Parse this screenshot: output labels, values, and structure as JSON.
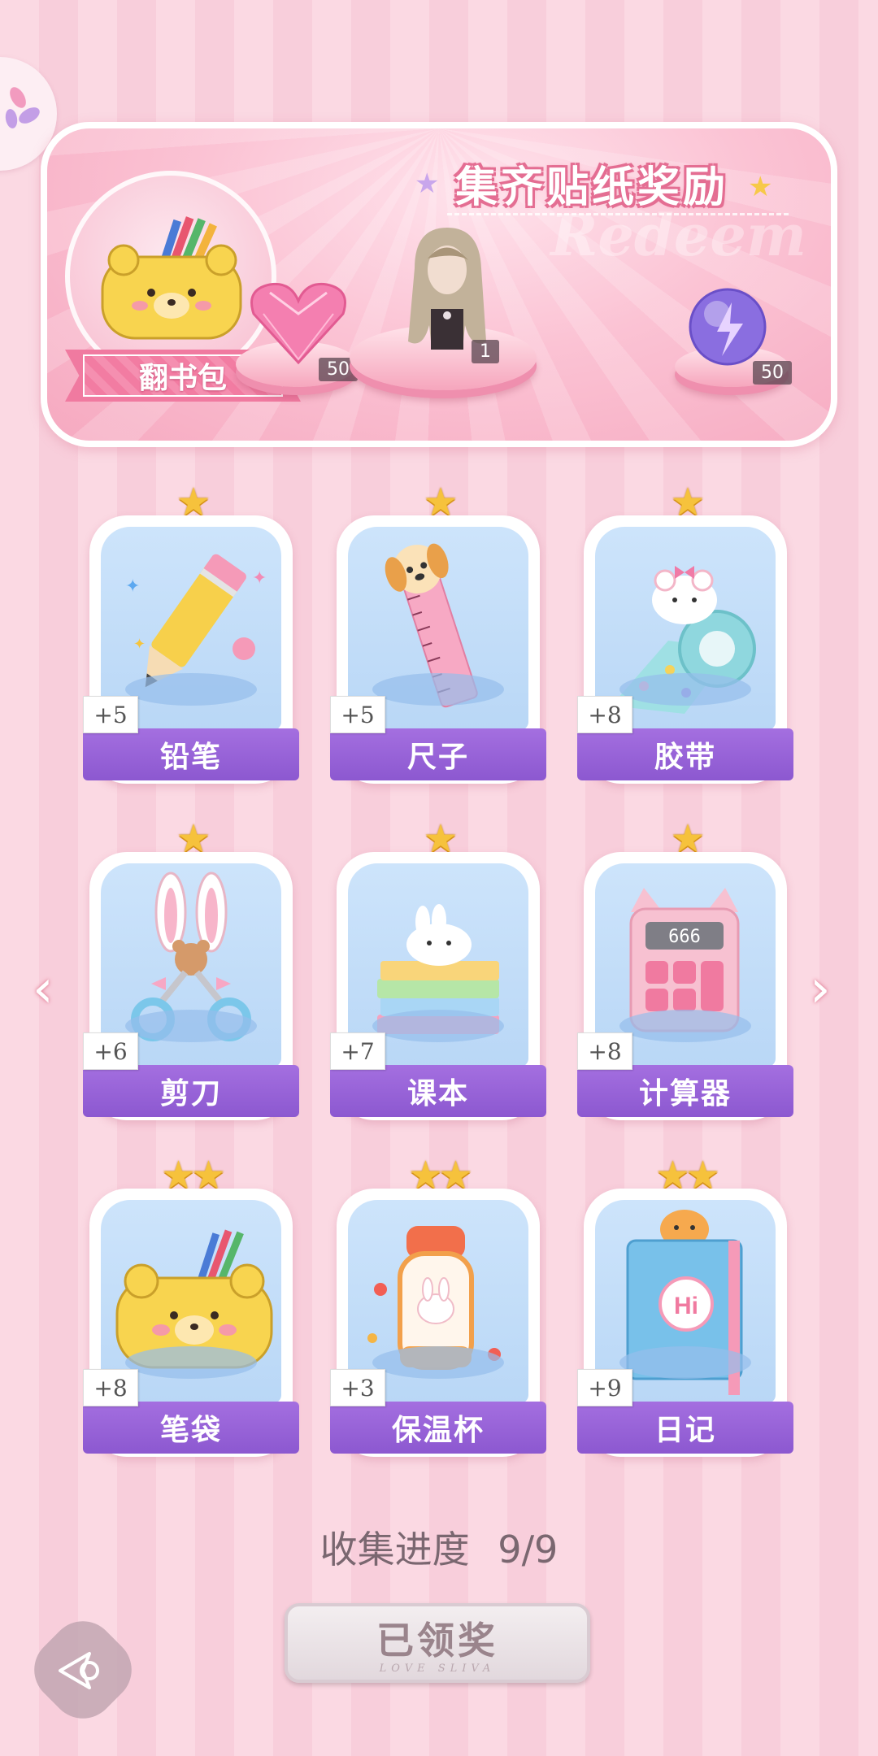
{
  "banner": {
    "title": "集齐贴纸奖励",
    "watermark": "Redeem",
    "source_label": "翻书包",
    "rewards": [
      {
        "icon": "pink-heart-gem-icon",
        "count": "50"
      },
      {
        "icon": "character-outfit-icon",
        "count": "1"
      },
      {
        "icon": "purple-energy-orb-icon",
        "count": "50"
      }
    ]
  },
  "cards": [
    {
      "name": "铅笔",
      "plus": "+5",
      "stars": "★",
      "icon": "pencil-icon"
    },
    {
      "name": "尺子",
      "plus": "+5",
      "stars": "★",
      "icon": "ruler-icon"
    },
    {
      "name": "胶带",
      "plus": "+8",
      "stars": "★",
      "icon": "tape-icon"
    },
    {
      "name": "剪刀",
      "plus": "+6",
      "stars": "★",
      "icon": "scissors-icon"
    },
    {
      "name": "课本",
      "plus": "+7",
      "stars": "★",
      "icon": "books-icon"
    },
    {
      "name": "计算器",
      "plus": "+8",
      "stars": "★",
      "icon": "calculator-icon"
    },
    {
      "name": "笔袋",
      "plus": "+8",
      "stars": "★★",
      "icon": "pencil-case-icon"
    },
    {
      "name": "保温杯",
      "plus": "+3",
      "stars": "★★",
      "icon": "thermos-icon"
    },
    {
      "name": "日记",
      "plus": "+9",
      "stars": "★★",
      "icon": "diary-icon"
    }
  ],
  "calculator_display": "666",
  "diary_text": "Hi",
  "progress": {
    "label": "收集进度",
    "value": "9/9"
  },
  "claim_button": {
    "label": "已领奖",
    "sub": "LOVE SLIVA"
  },
  "nav": {
    "prev": "‹",
    "next": "›"
  },
  "colors": {
    "card_banner": "#9a63d8",
    "background": "#fbd9e3",
    "accent_pink": "#f07aa0",
    "star": "#f6c23c"
  }
}
